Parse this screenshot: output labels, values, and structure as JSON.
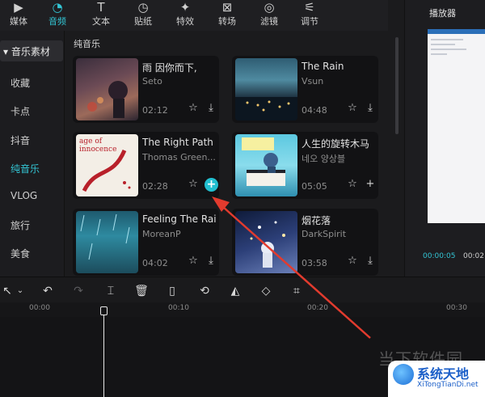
{
  "toolbar": {
    "items": [
      {
        "label": "媒体",
        "icon": "media-icon"
      },
      {
        "label": "音频",
        "icon": "audio-icon",
        "active": true
      },
      {
        "label": "文本",
        "icon": "text-icon"
      },
      {
        "label": "贴纸",
        "icon": "sticker-icon"
      },
      {
        "label": "特效",
        "icon": "effects-icon"
      },
      {
        "label": "转场",
        "icon": "transition-icon"
      },
      {
        "label": "滤镜",
        "icon": "filter-icon"
      },
      {
        "label": "调节",
        "icon": "adjust-icon"
      }
    ]
  },
  "sidebar": {
    "header": "音乐素材",
    "items": [
      "收藏",
      "卡点",
      "抖音",
      "纯音乐",
      "VLOG",
      "旅行",
      "美食"
    ],
    "active": "纯音乐"
  },
  "panel": {
    "section_title": "纯音乐",
    "tracks": [
      {
        "title": "雨 因你而下,",
        "artist": "Seto",
        "duration": "02:12"
      },
      {
        "title": "The Rain",
        "artist": "Vsun",
        "duration": "04:48"
      },
      {
        "title": "The Right Path",
        "artist": "Thomas Green...",
        "duration": "02:28",
        "thumb_text": "age of innocence",
        "hover": true
      },
      {
        "title": "人生的旋转木马",
        "artist": "네오 양상블",
        "duration": "05:05"
      },
      {
        "title": "Feeling The Rain",
        "artist": "MoreanP",
        "duration": "04:02"
      },
      {
        "title": "烟花落",
        "artist": "DarkSpirit",
        "duration": "03:58"
      }
    ]
  },
  "player": {
    "title": "播放器",
    "current_time": "00:00:05",
    "total_time": "00:02"
  },
  "timeline": {
    "ticks": [
      "00:00",
      "00:10",
      "00:20",
      "00:30"
    ]
  },
  "watermark": {
    "site_cn": "当下软件园",
    "name": "系统天地",
    "url": "XiTongTianDi.net"
  },
  "colors": {
    "accent": "#33c5d4",
    "arrow": "#e23b2e"
  }
}
